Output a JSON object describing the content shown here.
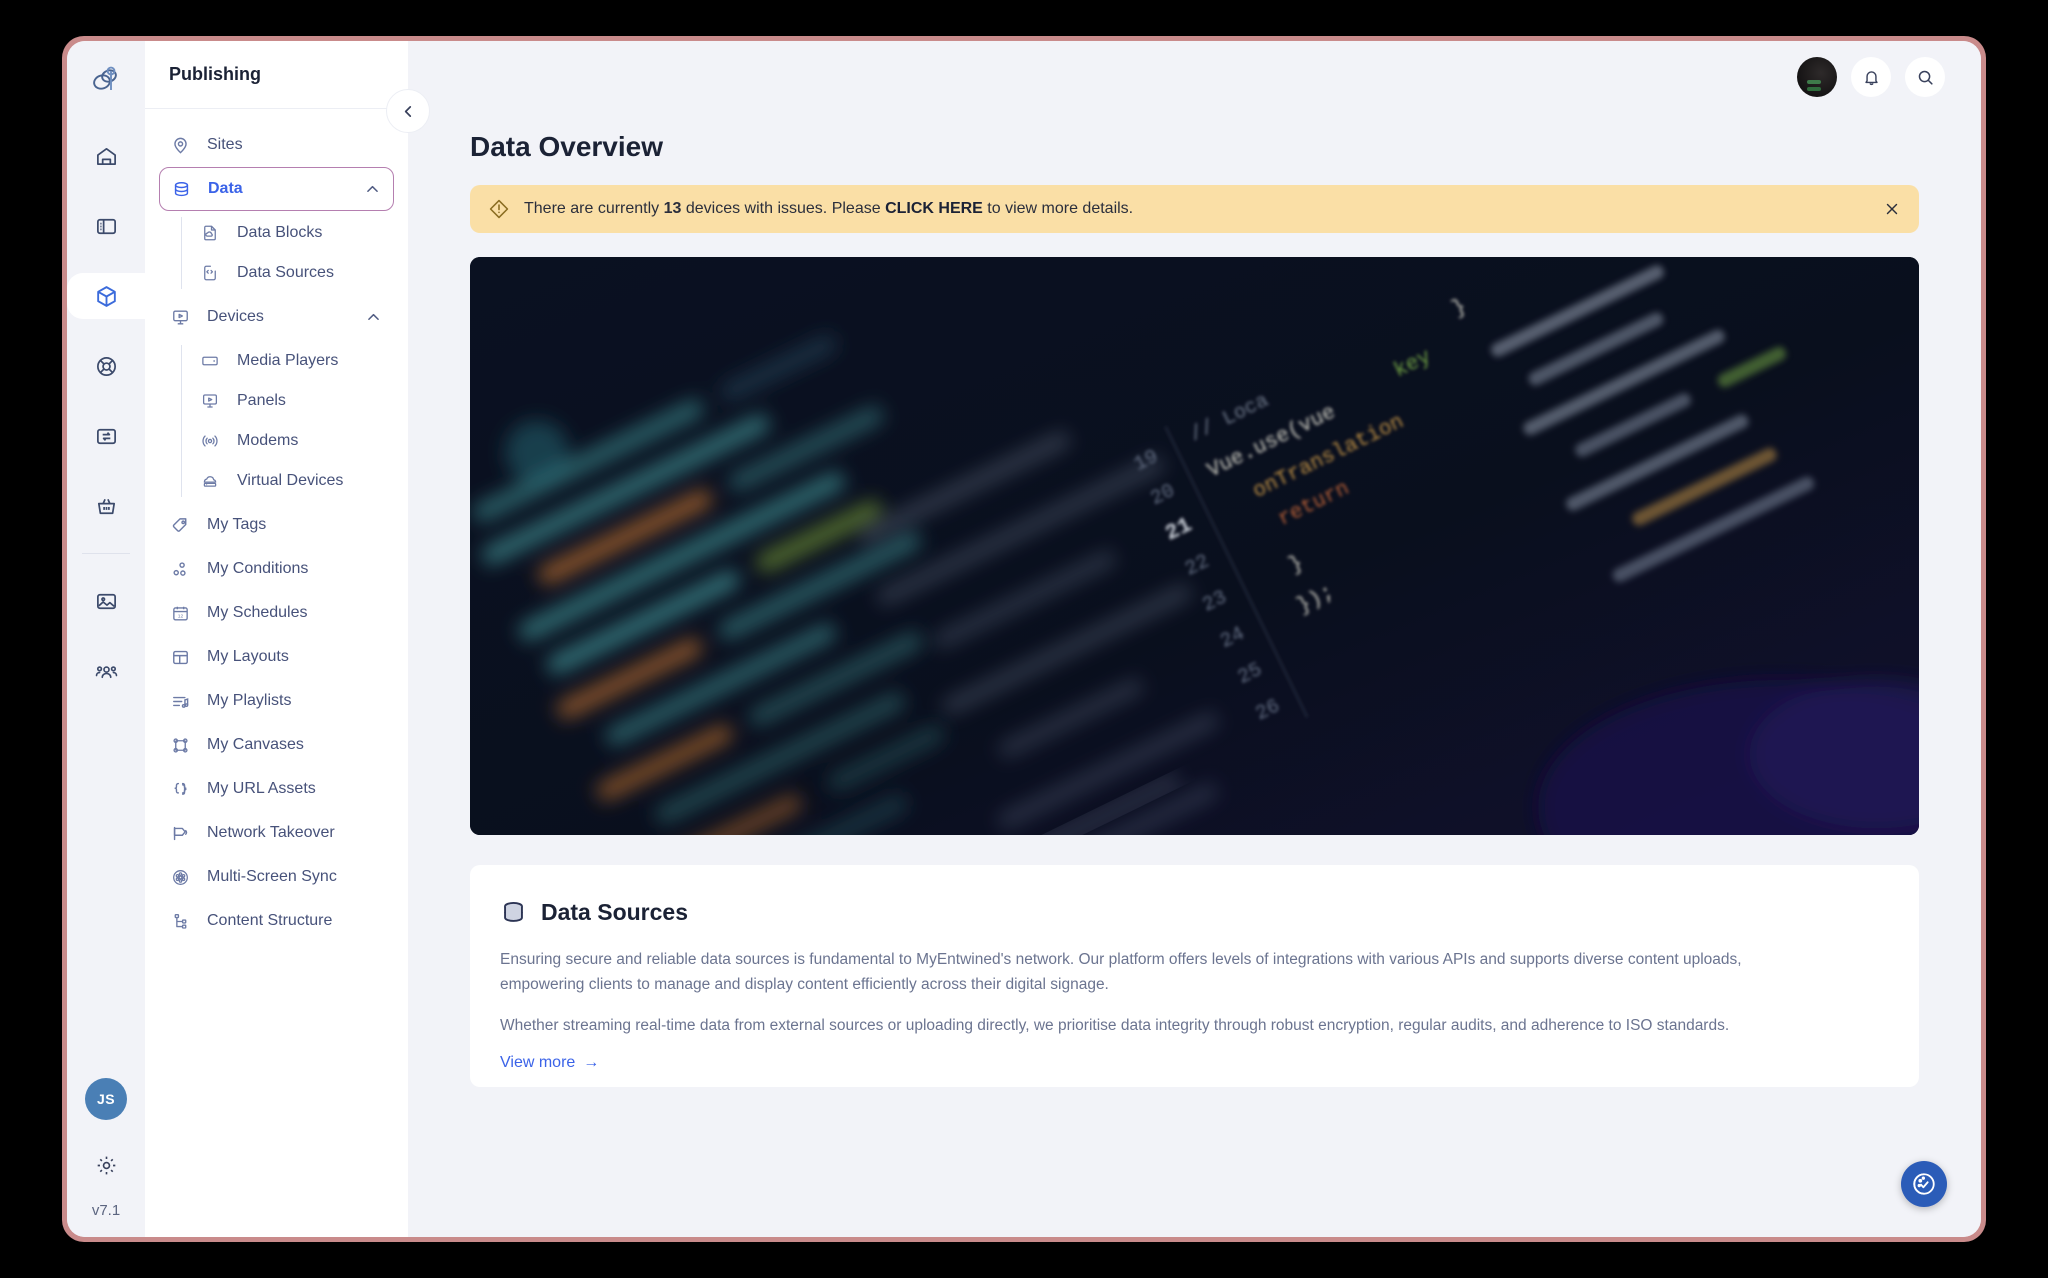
{
  "rail": {
    "logo_icon": "entwined-logo-icon",
    "icons": [
      {
        "name": "home-icon",
        "active": false
      },
      {
        "name": "dashboard-panel-icon",
        "active": false
      },
      {
        "name": "package-box-icon",
        "active": true
      },
      {
        "name": "lifebuoy-support-icon",
        "active": false
      },
      {
        "name": "exchange-sync-icon",
        "active": false
      },
      {
        "name": "basket-shop-icon",
        "active": false
      },
      {
        "name": "image-gallery-icon",
        "active": false
      },
      {
        "name": "users-group-icon",
        "active": false
      }
    ],
    "avatar_initials": "JS",
    "settings_icon": "gear-icon",
    "version": "v7.1"
  },
  "nav": {
    "title": "Publishing",
    "collapse_icon": "chevron-left-icon",
    "items": [
      {
        "label": "Sites",
        "icon": "map-pin-icon",
        "selected": false
      },
      {
        "label": "Data",
        "icon": "database-icon",
        "selected": true,
        "expanded": true,
        "children": [
          {
            "label": "Data Blocks",
            "icon": "file-cloud-icon"
          },
          {
            "label": "Data Sources",
            "icon": "file-code-icon"
          }
        ]
      },
      {
        "label": "Devices",
        "icon": "monitor-play-icon",
        "selected": false,
        "expanded": true,
        "children": [
          {
            "label": "Media Players",
            "icon": "media-player-icon"
          },
          {
            "label": "Panels",
            "icon": "panel-screen-icon"
          },
          {
            "label": "Modems",
            "icon": "modem-signal-icon"
          },
          {
            "label": "Virtual Devices",
            "icon": "virtual-device-icon"
          }
        ]
      },
      {
        "label": "My Tags",
        "icon": "tag-icon",
        "selected": false
      },
      {
        "label": "My Conditions",
        "icon": "conditions-nodes-icon",
        "selected": false
      },
      {
        "label": "My Schedules",
        "icon": "calendar-12-icon",
        "selected": false
      },
      {
        "label": "My Layouts",
        "icon": "layout-grid-icon",
        "selected": false
      },
      {
        "label": "My Playlists",
        "icon": "playlist-music-icon",
        "selected": false
      },
      {
        "label": "My Canvases",
        "icon": "canvas-nodes-icon",
        "selected": false
      },
      {
        "label": "My URL Assets",
        "icon": "curly-braces-icon",
        "selected": false
      },
      {
        "label": "Network Takeover",
        "icon": "megaphone-icon",
        "selected": false
      },
      {
        "label": "Multi-Screen Sync",
        "icon": "film-reel-icon",
        "selected": false
      },
      {
        "label": "Content Structure",
        "icon": "sitemap-tree-icon",
        "selected": false
      }
    ]
  },
  "topbar": {
    "avatar_icon": "user-avatar",
    "notifications_icon": "bell-icon",
    "search_icon": "search-icon"
  },
  "page": {
    "title": "Data Overview"
  },
  "alert": {
    "icon": "warning-diamond-icon",
    "prefix": "There are currently ",
    "count": "13",
    "middle": " devices with issues. Please ",
    "link": "CLICK HERE",
    "suffix": " to view more details.",
    "close_icon": "close-icon",
    "background_color": "#fadfa6"
  },
  "hero": {
    "alt": "blurred dark code editor screenshot",
    "background_color": "#0b1020",
    "code_snippets": [
      "19",
      "20",
      "21",
      "22",
      "23",
      "24",
      "25",
      "26",
      "// Loca",
      "Vue.use(vue",
      "onTranslation",
      "return",
      "}",
      "});"
    ]
  },
  "card": {
    "icon": "database-icon",
    "title": "Data Sources",
    "paragraph1": "Ensuring secure and reliable data sources is fundamental to MyEntwined's network. Our platform offers levels of integrations with various APIs and supports diverse content uploads, empowering clients to manage and display content efficiently across their digital signage.",
    "paragraph2": "Whether streaming real-time data from external sources or uploading directly, we prioritise data integrity through robust encryption, regular audits, and adherence to ISO standards.",
    "link": "View more",
    "link_arrow": "→",
    "link_color": "#3b63e8"
  },
  "fab": {
    "icon": "cookie-check-icon",
    "color": "#2b5cb8"
  }
}
